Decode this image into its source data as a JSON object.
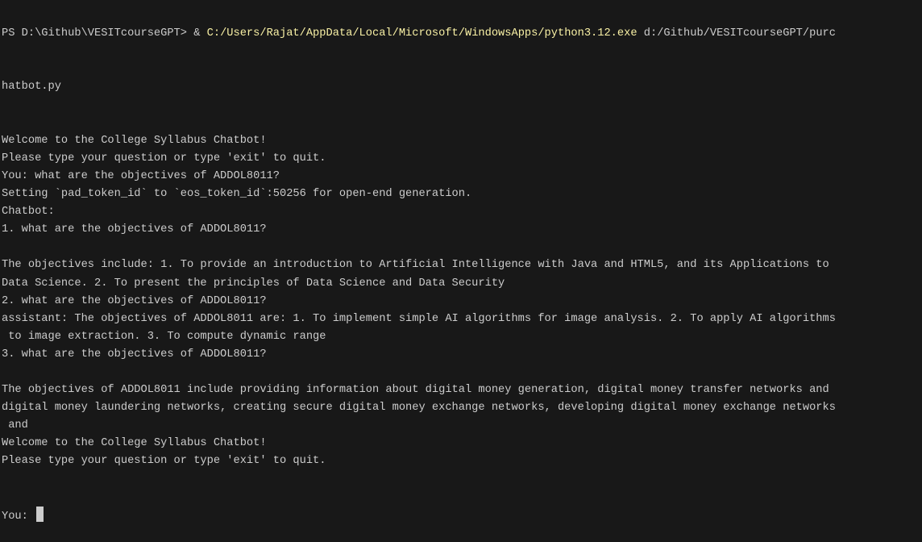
{
  "terminal": {
    "command": {
      "prompt": "PS D:\\Github\\VESITcourseGPT> & ",
      "exe": "C:/Users/Rajat/AppData/Local/Microsoft/WindowsApps/python3.12.exe",
      "arg": " d:/Github/VESITcourseGPT/purc",
      "arg_wrap": "hatbot.py"
    },
    "lines": [
      "Welcome to the College Syllabus Chatbot!",
      "Please type your question or type 'exit' to quit.",
      "You: what are the objectives of ADDOL8011?",
      "Setting `pad_token_id` to `eos_token_id`:50256 for open-end generation.",
      "Chatbot:",
      "1. what are the objectives of ADDOL8011?",
      "",
      "The objectives include: 1. To provide an introduction to Artificial Intelligence with Java and HTML5, and its Applications to",
      "Data Science. 2. To present the principles of Data Science and Data Security",
      "2. what are the objectives of ADDOL8011?",
      "assistant: The objectives of ADDOL8011 are: 1. To implement simple AI algorithms for image analysis. 2. To apply AI algorithms",
      " to image extraction. 3. To compute dynamic range",
      "3. what are the objectives of ADDOL8011?",
      "",
      "The objectives of ADDOL8011 include providing information about digital money generation, digital money transfer networks and",
      "digital money laundering networks, creating secure digital money exchange networks, developing digital money exchange networks",
      " and",
      "Welcome to the College Syllabus Chatbot!",
      "Please type your question or type 'exit' to quit."
    ],
    "input_prompt": "You: "
  }
}
